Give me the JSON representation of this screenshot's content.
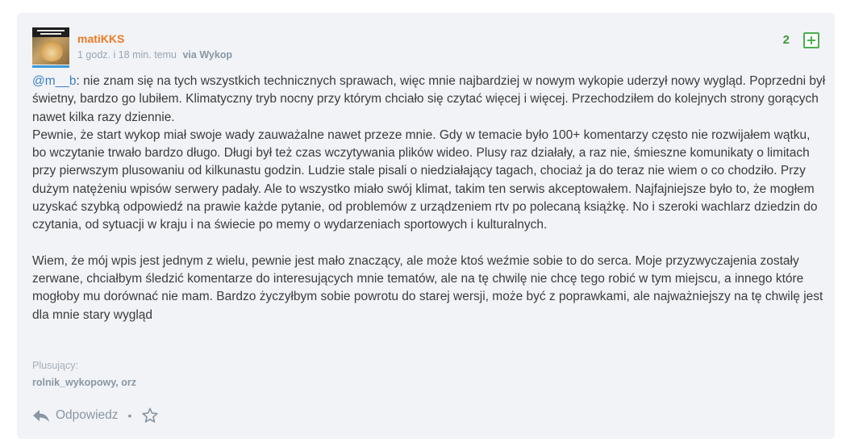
{
  "comment": {
    "username": "matiKKS",
    "time": "1 godz. i 18 min. temu",
    "via": "via Wykop",
    "votes": "2",
    "mention": "@m__b",
    "paragraph1": ": nie znam się na tych wszystkich technicznych sprawach, więc mnie najbardziej w nowym wykopie uderzył nowy wygląd. Poprzedni był świetny, bardzo go lubiłem. Klimatyczny tryb nocny przy którym chciało się czytać więcej i więcej. Przechodziłem do kolejnych strony gorących nawet kilka razy dziennie.",
    "paragraph2": "Pewnie, że start wykop miał swoje wady zauważalne nawet przeze mnie. Gdy w temacie było 100+ komentarzy często nie rozwijałem wątku, bo wczytanie trwało bardzo długo. Długi był też czas wczytywania plików wideo. Plusy raz działały, a raz nie, śmieszne komunikaty o limitach przy pierwszym plusowaniu od kilkunastu godzin. Ludzie stale pisali o niedziałający tagach, chociaż ja do teraz nie wiem o co chodziło. Przy dużym natężeniu wpisów serwery padały. Ale to wszystko miało swój klimat, takim ten serwis akceptowałem. Najfajniejsze było to, że mogłem uzyskać szybką odpowiedź na prawie każde pytanie, od problemów z urządzeniem rtv po polecaną książkę. No i szeroki wachlarz dziedzin do czytania, od sytuacji w kraju i na świecie po memy o wydarzeniach sportowych i kulturalnych.",
    "paragraph3": "Wiem, że mój wpis jest jednym z wielu, pewnie jest mało znaczący, ale może ktoś weźmie sobie to do serca. Moje przyzwyczajenia zostały zerwane, chciałbym śledzić komentarze do interesujących mnie tematów, ale na tę chwilę nie chcę tego robić w tym miejscu, a innego które mogłoby mu dorównać nie mam. Bardzo życzyłbym sobie powrotu do starej wersji, może być z poprawkami, ale najważniejszy na tę chwilę jest dla mnie stary wygląd",
    "plus_label": "Plusujący:",
    "plus_users": "rolnik_wykopowy, orz",
    "reply_label": "Odpowiedz",
    "separator": "•"
  },
  "icons": {
    "plus": "plus-square-icon",
    "reply": "reply-arrow-icon",
    "favorite": "star-outline-icon"
  },
  "colors": {
    "username": "#ec7b24",
    "mention": "#3c7fc4",
    "votes": "#3c9a33",
    "card_background": "#f1f3f6"
  }
}
